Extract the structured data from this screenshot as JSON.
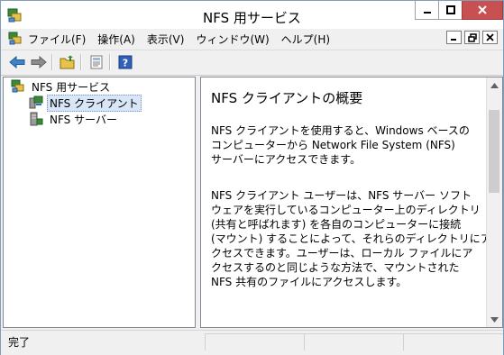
{
  "window": {
    "title": "NFS 用サービス"
  },
  "menu": {
    "items": [
      {
        "label": "ファイル(F)"
      },
      {
        "label": "操作(A)"
      },
      {
        "label": "表示(V)"
      },
      {
        "label": "ウィンドウ(W)"
      },
      {
        "label": "ヘルプ(H)"
      }
    ]
  },
  "toolbar": {
    "icons": [
      "back-arrow-icon",
      "forward-arrow-icon",
      "up-folder-icon",
      "properties-icon",
      "help-icon"
    ]
  },
  "tree": {
    "root": {
      "label": "NFS 用サービス"
    },
    "children": [
      {
        "label": "NFS クライアント",
        "selected": true
      },
      {
        "label": "NFS サーバー",
        "selected": false
      }
    ]
  },
  "detail": {
    "title": "NFS クライアントの概要",
    "paragraph1": [
      "NFS クライアントを使用すると、Windows ベースの",
      "コンピューターから Network File System (NFS)",
      "サーバーにアクセスできます。"
    ],
    "paragraph2": [
      "NFS クライアント ユーザーは、NFS サーバー ソフト",
      "ウェアを実行しているコンピューター上のディレクトリ",
      "(共有と呼ばれます) を各自のコンピューターに接続",
      "(マウント) することによって、それらのディレクトリにア",
      "クセスできます。ユーザーは、ローカル ファイルにア",
      "クセスするのと同じような方法で、マウントされた",
      "NFS 共有のファイルにアクセスします。"
    ]
  },
  "status": {
    "text": "完了"
  },
  "colors": {
    "close_button": "#c75050",
    "selection": "#d9e6f7"
  }
}
